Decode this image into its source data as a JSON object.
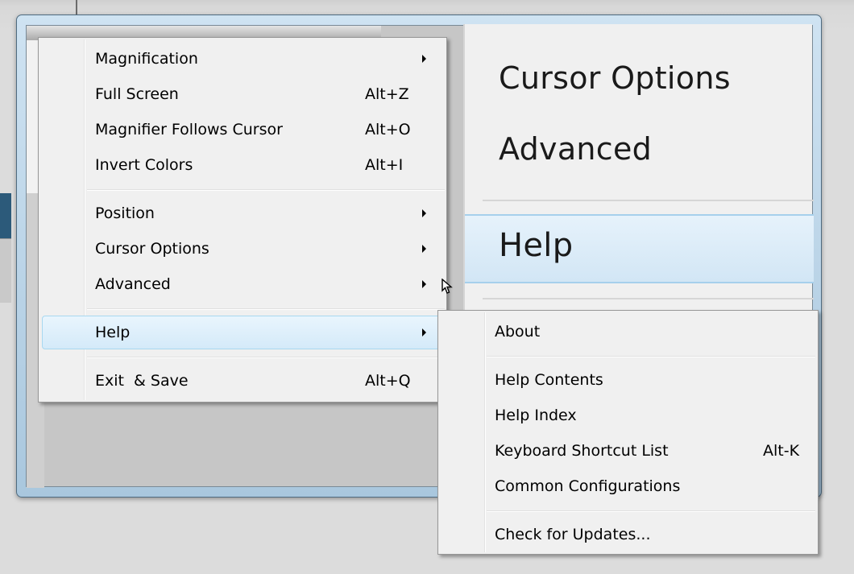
{
  "magnified_view": {
    "cursor_options": "Cursor Options",
    "advanced": "Advanced",
    "help": "Help"
  },
  "main_menu": {
    "magnification": "Magnification",
    "full_screen": "Full Screen",
    "full_screen_shortcut": "Alt+Z",
    "follows_cursor": "Magnifier Follows Cursor",
    "follows_cursor_shortcut": "Alt+O",
    "invert_colors": "Invert Colors",
    "invert_colors_shortcut": "Alt+I",
    "position": "Position",
    "cursor_options": "Cursor Options",
    "advanced": "Advanced",
    "help": "Help",
    "exit_save": "Exit  & Save",
    "exit_save_shortcut": "Alt+Q"
  },
  "help_submenu": {
    "about": "About",
    "help_contents": "Help Contents",
    "help_index": "Help Index",
    "keyboard_shortcut_list": "Keyboard Shortcut List",
    "keyboard_shortcut_list_shortcut": "Alt-K",
    "common_configurations": "Common Configurations",
    "check_for_updates": "Check for Updates..."
  },
  "icons": {
    "submenu_arrow": "submenu-arrow-icon",
    "cursor": "mouse-cursor-icon"
  },
  "colors": {
    "menu_background": "#f0f0f0",
    "highlight_border": "#a8d8f0",
    "highlight_fill": "#d4eaf9"
  }
}
